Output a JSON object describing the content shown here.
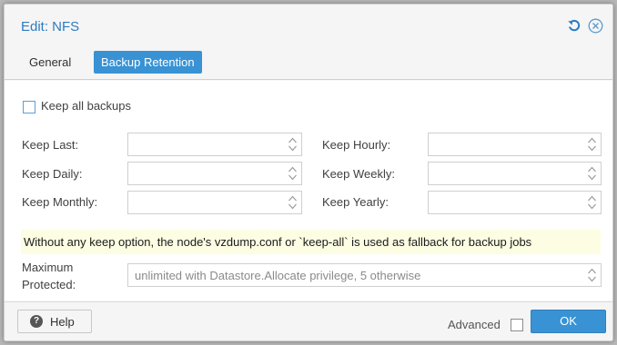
{
  "window": {
    "title": "Edit: NFS"
  },
  "header_tools": {
    "reset_icon": "undo-icon",
    "close_icon": "close-circle-icon"
  },
  "tabs": [
    {
      "label": "General",
      "active": false
    },
    {
      "label": "Backup Retention",
      "active": true
    }
  ],
  "keep_all": {
    "label": "Keep all backups",
    "checked": false
  },
  "fields": {
    "keep_last": {
      "label": "Keep Last:",
      "value": ""
    },
    "keep_hourly": {
      "label": "Keep Hourly:",
      "value": ""
    },
    "keep_daily": {
      "label": "Keep Daily:",
      "value": ""
    },
    "keep_weekly": {
      "label": "Keep Weekly:",
      "value": ""
    },
    "keep_monthly": {
      "label": "Keep Monthly:",
      "value": ""
    },
    "keep_yearly": {
      "label": "Keep Yearly:",
      "value": ""
    }
  },
  "notice": "Without any keep option, the node's vzdump.conf or `keep-all` is used as fallback for backup jobs",
  "max_protected": {
    "label_line1": "Maximum",
    "label_line2": "Protected:",
    "placeholder": "unlimited with Datastore.Allocate privilege, 5 otherwise"
  },
  "footer": {
    "help_label": "Help",
    "advanced_label": "Advanced",
    "advanced_checked": false,
    "ok_label": "OK"
  },
  "colors": {
    "accent": "#3892d4",
    "title": "#2b7bc0",
    "notice_bg": "#fdfde3"
  }
}
